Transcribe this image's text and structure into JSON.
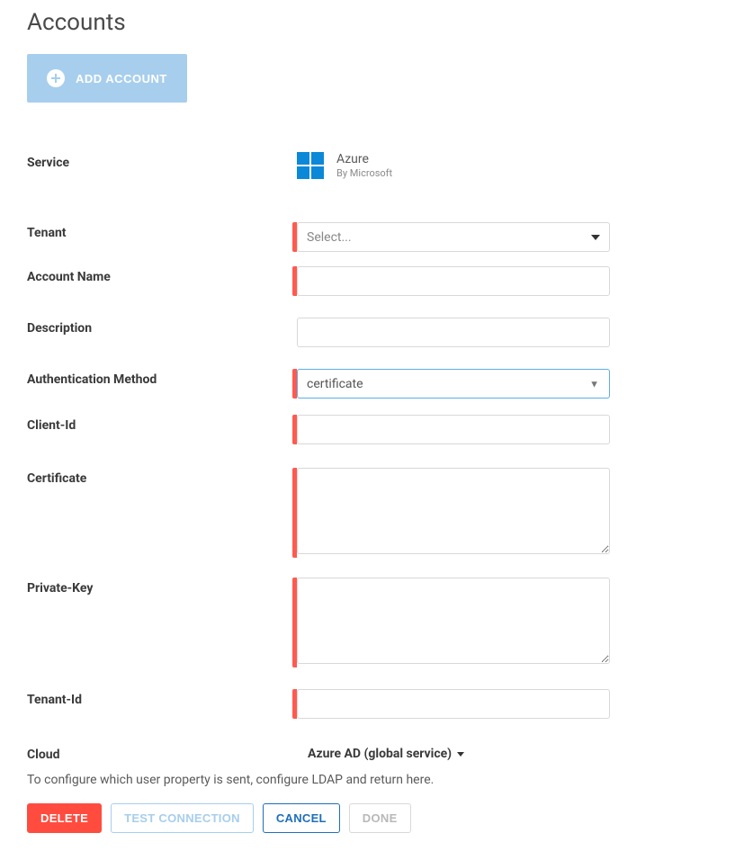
{
  "page": {
    "title": "Accounts"
  },
  "toolbar": {
    "add_account_label": "ADD ACCOUNT"
  },
  "form": {
    "service": {
      "label": "Service",
      "name": "Azure",
      "vendor": "By Microsoft"
    },
    "tenant": {
      "label": "Tenant",
      "placeholder": "Select..."
    },
    "account_name": {
      "label": "Account Name",
      "value": ""
    },
    "description": {
      "label": "Description",
      "value": ""
    },
    "auth_method": {
      "label": "Authentication Method",
      "value": "certificate"
    },
    "client_id": {
      "label": "Client-Id",
      "value": ""
    },
    "certificate": {
      "label": "Certificate",
      "value": ""
    },
    "private_key": {
      "label": "Private-Key",
      "value": ""
    },
    "tenant_id": {
      "label": "Tenant-Id",
      "value": ""
    },
    "cloud": {
      "label": "Cloud",
      "value": "Azure AD (global service)"
    },
    "info_text": "To configure which user property is sent, configure LDAP and return here."
  },
  "buttons": {
    "delete": "DELETE",
    "test_connection": "TEST CONNECTION",
    "cancel": "CANCEL",
    "done": "DONE"
  }
}
